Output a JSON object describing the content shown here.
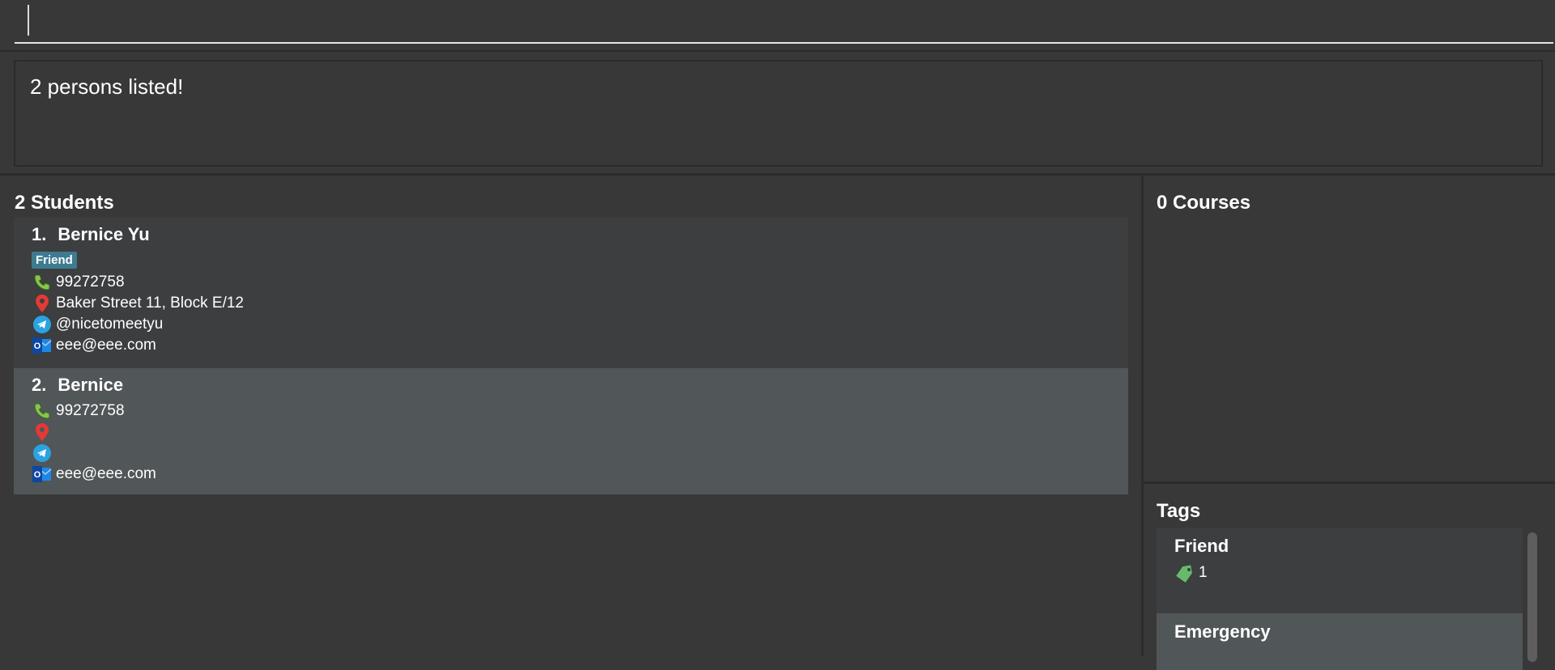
{
  "command": {
    "value": ""
  },
  "result": {
    "text": "2 persons listed!"
  },
  "students": {
    "title": "2 Students",
    "items": [
      {
        "index": "1.",
        "name": "Bernice Yu",
        "tags": [
          "Friend"
        ],
        "phone": "99272758",
        "address": "Baker Street 11, Block E/12",
        "telegram": "@nicetomeetyu",
        "email": "eee@eee.com"
      },
      {
        "index": "2.",
        "name": "Bernice",
        "tags": [],
        "phone": "99272758",
        "address": "",
        "telegram": "",
        "email": "eee@eee.com"
      }
    ]
  },
  "courses": {
    "title": "0 Courses"
  },
  "tags": {
    "title": "Tags",
    "items": [
      {
        "name": "Friend",
        "count": "1"
      },
      {
        "name": "Emergency",
        "count": ""
      }
    ]
  },
  "colors": {
    "background": "#383838",
    "card_odd": "#3c3e3f",
    "card_even": "#515658",
    "tag": "#3e7b91"
  }
}
